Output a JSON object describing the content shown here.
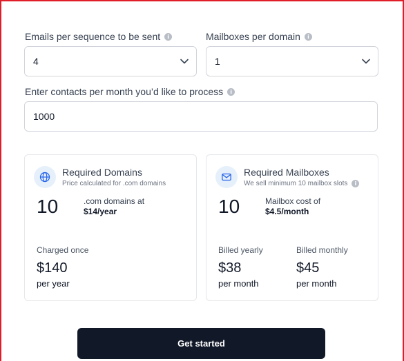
{
  "form": {
    "emails_label": "Emails per sequence to be sent",
    "emails_value": "4",
    "mailboxes_label": "Mailboxes per domain",
    "mailboxes_value": "1",
    "contacts_label": "Enter contacts per month you’d like to process",
    "contacts_value": "1000"
  },
  "domains_card": {
    "title": "Required Domains",
    "subtitle": "Price calculated for .com domains",
    "count": "10",
    "unit_line1": ".com domains at",
    "unit_line2": "$14/year",
    "charge_label": "Charged once",
    "charge_price": "$140",
    "charge_period": "per year",
    "icon": "globe-icon"
  },
  "mailboxes_card": {
    "title": "Required Mailboxes",
    "subtitle": "We sell minimum 10 mailbox slots",
    "count": "10",
    "unit_line1": "Mailbox cost of",
    "unit_line2": "$4.5/month",
    "yearly_label": "Billed yearly",
    "yearly_price": "$38",
    "yearly_period": "per month",
    "monthly_label": "Billed monthly",
    "monthly_price": "$45",
    "monthly_period": "per month",
    "icon": "mail-icon"
  },
  "cta": {
    "label": "Get started"
  },
  "colors": {
    "primary": "#111827",
    "accent_icon": "#2563eb",
    "frame": "#e11d2a"
  }
}
